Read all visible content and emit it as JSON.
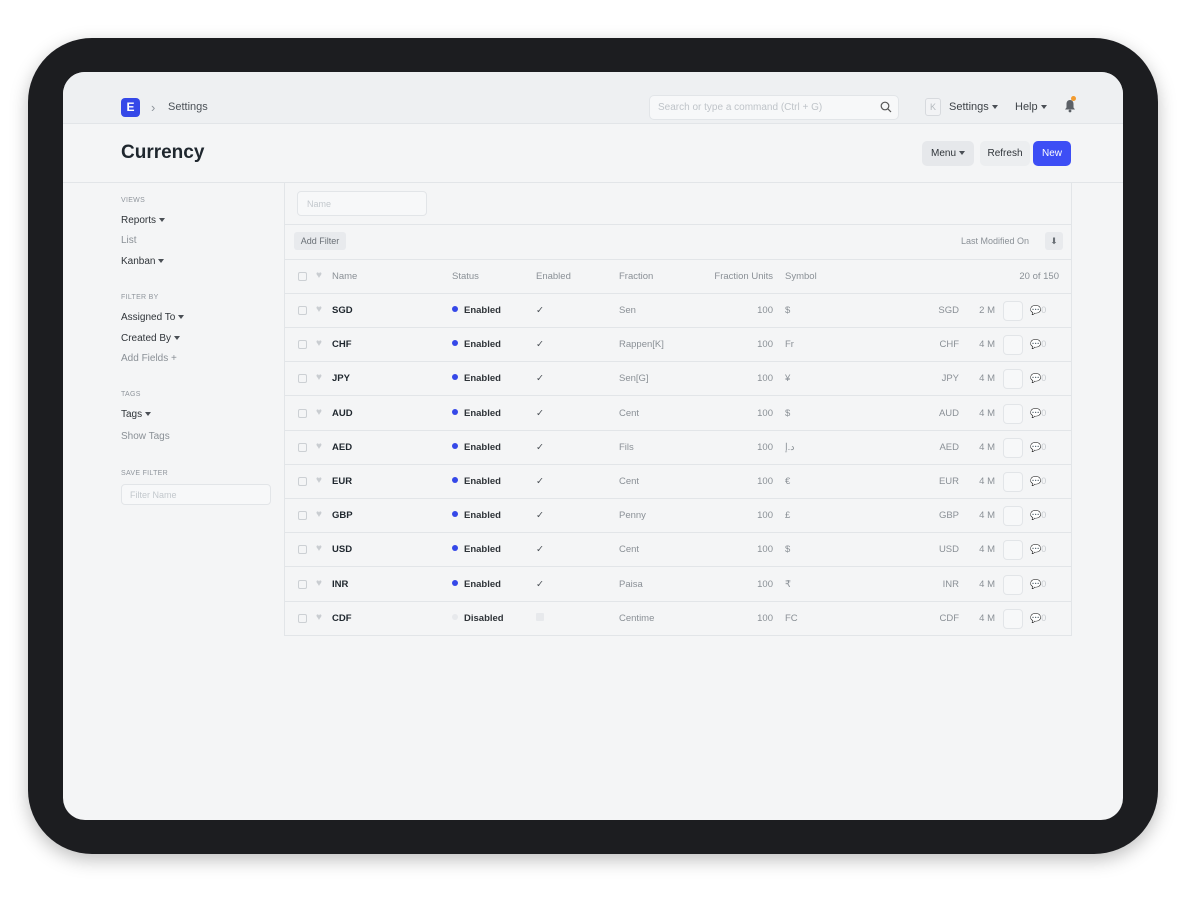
{
  "navbar": {
    "logo_letter": "E",
    "breadcrumb": "Settings",
    "search_placeholder": "Search or type a command (Ctrl + G)",
    "avatar_letter": "K",
    "settings_label": "Settings",
    "help_label": "Help",
    "notification_color": "#f29b2f"
  },
  "page": {
    "title": "Currency",
    "menu_label": "Menu",
    "refresh_label": "Refresh",
    "new_label": "New",
    "accent": "#3d4ef5"
  },
  "sidebar": {
    "views_label": "VIEWS",
    "views": [
      "Reports",
      "List",
      "Kanban"
    ],
    "filter_by_label": "FILTER BY",
    "assigned_to": "Assigned To",
    "created_by": "Created By",
    "add_fields": "Add Fields",
    "tags_label": "TAGS",
    "tags": "Tags",
    "show_tags": "Show Tags",
    "save_filter_label": "SAVE FILTER",
    "filter_name_placeholder": "Filter Name"
  },
  "list": {
    "name_placeholder": "Name",
    "add_filter": "Add Filter",
    "sort_label": "Last Modified On",
    "columns": {
      "name": "Name",
      "status": "Status",
      "enabled": "Enabled",
      "fraction": "Fraction",
      "fraction_units": "Fraction Units",
      "symbol": "Symbol",
      "count": "20 of 150"
    },
    "rows": [
      {
        "name": "SGD",
        "status": "Enabled",
        "enabled": true,
        "fraction": "Sen",
        "units": "100",
        "symbol": "$",
        "code": "SGD",
        "modified": "2 M",
        "comments": "0"
      },
      {
        "name": "CHF",
        "status": "Enabled",
        "enabled": true,
        "fraction": "Rappen[K]",
        "units": "100",
        "symbol": "Fr",
        "code": "CHF",
        "modified": "4 M",
        "comments": "0"
      },
      {
        "name": "JPY",
        "status": "Enabled",
        "enabled": true,
        "fraction": "Sen[G]",
        "units": "100",
        "symbol": "¥",
        "code": "JPY",
        "modified": "4 M",
        "comments": "0"
      },
      {
        "name": "AUD",
        "status": "Enabled",
        "enabled": true,
        "fraction": "Cent",
        "units": "100",
        "symbol": "$",
        "code": "AUD",
        "modified": "4 M",
        "comments": "0"
      },
      {
        "name": "AED",
        "status": "Enabled",
        "enabled": true,
        "fraction": "Fils",
        "units": "100",
        "symbol": "د.إ",
        "code": "AED",
        "modified": "4 M",
        "comments": "0"
      },
      {
        "name": "EUR",
        "status": "Enabled",
        "enabled": true,
        "fraction": "Cent",
        "units": "100",
        "symbol": "€",
        "code": "EUR",
        "modified": "4 M",
        "comments": "0"
      },
      {
        "name": "GBP",
        "status": "Enabled",
        "enabled": true,
        "fraction": "Penny",
        "units": "100",
        "symbol": "£",
        "code": "GBP",
        "modified": "4 M",
        "comments": "0"
      },
      {
        "name": "USD",
        "status": "Enabled",
        "enabled": true,
        "fraction": "Cent",
        "units": "100",
        "symbol": "$",
        "code": "USD",
        "modified": "4 M",
        "comments": "0"
      },
      {
        "name": "INR",
        "status": "Enabled",
        "enabled": true,
        "fraction": "Paisa",
        "units": "100",
        "symbol": "₹",
        "code": "INR",
        "modified": "4 M",
        "comments": "0"
      },
      {
        "name": "CDF",
        "status": "Disabled",
        "enabled": false,
        "fraction": "Centime",
        "units": "100",
        "symbol": "FC",
        "code": "CDF",
        "modified": "4 M",
        "comments": "0"
      }
    ]
  }
}
